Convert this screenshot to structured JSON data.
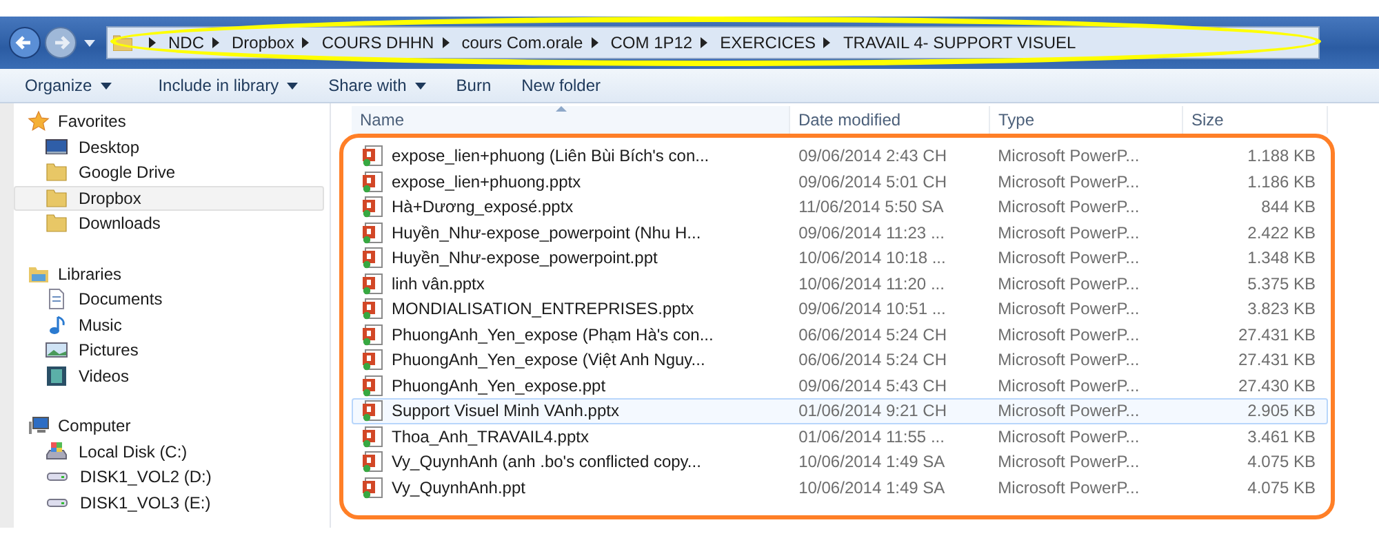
{
  "address_bar": {
    "crumbs": [
      "NDC",
      "Dropbox",
      "COURS DHHN",
      "cours Com.orale",
      "COM  1P12",
      "EXERCICES",
      "TRAVAIL 4- SUPPORT VISUEL"
    ]
  },
  "toolbar": {
    "buttons": [
      {
        "label": "Organize",
        "dropdown": true
      },
      {
        "label": "Include in library",
        "dropdown": true
      },
      {
        "label": "Share with",
        "dropdown": true
      },
      {
        "label": "Burn",
        "dropdown": false
      },
      {
        "label": "New folder",
        "dropdown": false
      }
    ]
  },
  "sidebar": {
    "groups": [
      {
        "label": "Favorites",
        "kind": "star",
        "items": [
          {
            "label": "Desktop",
            "kind": "desktop",
            "selected": false
          },
          {
            "label": "Google Drive",
            "kind": "folder",
            "selected": false
          },
          {
            "label": "Dropbox",
            "kind": "folder",
            "selected": true
          },
          {
            "label": "Downloads",
            "kind": "folder",
            "selected": false
          }
        ]
      },
      {
        "label": "Libraries",
        "kind": "library",
        "items": [
          {
            "label": "Documents",
            "kind": "document",
            "selected": false
          },
          {
            "label": "Music",
            "kind": "music",
            "selected": false
          },
          {
            "label": "Pictures",
            "kind": "picture",
            "selected": false
          },
          {
            "label": "Videos",
            "kind": "video",
            "selected": false
          }
        ]
      },
      {
        "label": "Computer",
        "kind": "computer",
        "items": [
          {
            "label": "Local Disk (C:)",
            "kind": "disk",
            "selected": false
          },
          {
            "label": "DISK1_VOL2 (D:)",
            "kind": "drive",
            "selected": false
          },
          {
            "label": "DISK1_VOL3 (E:)",
            "kind": "drive",
            "selected": false
          }
        ]
      }
    ]
  },
  "file_list": {
    "columns": [
      {
        "label": "Name",
        "sorted": true
      },
      {
        "label": "Date modified",
        "sorted": false
      },
      {
        "label": "Type",
        "sorted": false
      },
      {
        "label": "Size",
        "sorted": false
      }
    ],
    "rows": [
      {
        "name": "expose_lien+phuong (Liên Bùi Bích's con...",
        "date": "09/06/2014 2:43 CH",
        "type": "Microsoft PowerP...",
        "size": "1.188 KB",
        "selected": false
      },
      {
        "name": "expose_lien+phuong.pptx",
        "date": "09/06/2014 5:01 CH",
        "type": "Microsoft PowerP...",
        "size": "1.186 KB",
        "selected": false
      },
      {
        "name": "Hà+Dương_exposé.pptx",
        "date": "11/06/2014 5:50 SA",
        "type": "Microsoft PowerP...",
        "size": "844 KB",
        "selected": false
      },
      {
        "name": "Huyền_Như-expose_powerpoint (Nhu H...",
        "date": "09/06/2014 11:23 ...",
        "type": "Microsoft PowerP...",
        "size": "2.422 KB",
        "selected": false
      },
      {
        "name": "Huyền_Như-expose_powerpoint.ppt",
        "date": "10/06/2014 10:18 ...",
        "type": "Microsoft PowerP...",
        "size": "1.348 KB",
        "selected": false
      },
      {
        "name": "linh vân.pptx",
        "date": "10/06/2014 11:20 ...",
        "type": "Microsoft PowerP...",
        "size": "5.375 KB",
        "selected": false
      },
      {
        "name": "MONDIALISATION_ENTREPRISES.pptx",
        "date": "09/06/2014 10:51 ...",
        "type": "Microsoft PowerP...",
        "size": "3.823 KB",
        "selected": false
      },
      {
        "name": "PhuongAnh_Yen_expose (Phạm Hà's con...",
        "date": "06/06/2014 5:24 CH",
        "type": "Microsoft PowerP...",
        "size": "27.431 KB",
        "selected": false
      },
      {
        "name": "PhuongAnh_Yen_expose (Việt Anh Nguy...",
        "date": "06/06/2014 5:24 CH",
        "type": "Microsoft PowerP...",
        "size": "27.431 KB",
        "selected": false
      },
      {
        "name": "PhuongAnh_Yen_expose.ppt",
        "date": "09/06/2014 5:43 CH",
        "type": "Microsoft PowerP...",
        "size": "27.430 KB",
        "selected": false
      },
      {
        "name": "Support Visuel Minh VAnh.pptx",
        "date": "01/06/2014 9:21 CH",
        "type": "Microsoft PowerP...",
        "size": "2.905 KB",
        "selected": true
      },
      {
        "name": "Thoa_Anh_TRAVAIL4.pptx",
        "date": "01/06/2014 11:55 ...",
        "type": "Microsoft PowerP...",
        "size": "3.461 KB",
        "selected": false
      },
      {
        "name": "Vy_QuynhAnh (anh .bo's conflicted copy...",
        "date": "10/06/2014 1:49 SA",
        "type": "Microsoft PowerP...",
        "size": "4.075 KB",
        "selected": false
      },
      {
        "name": "Vy_QuynhAnh.ppt",
        "date": "10/06/2014 1:49 SA",
        "type": "Microsoft PowerP...",
        "size": "4.075 KB",
        "selected": false
      }
    ]
  }
}
